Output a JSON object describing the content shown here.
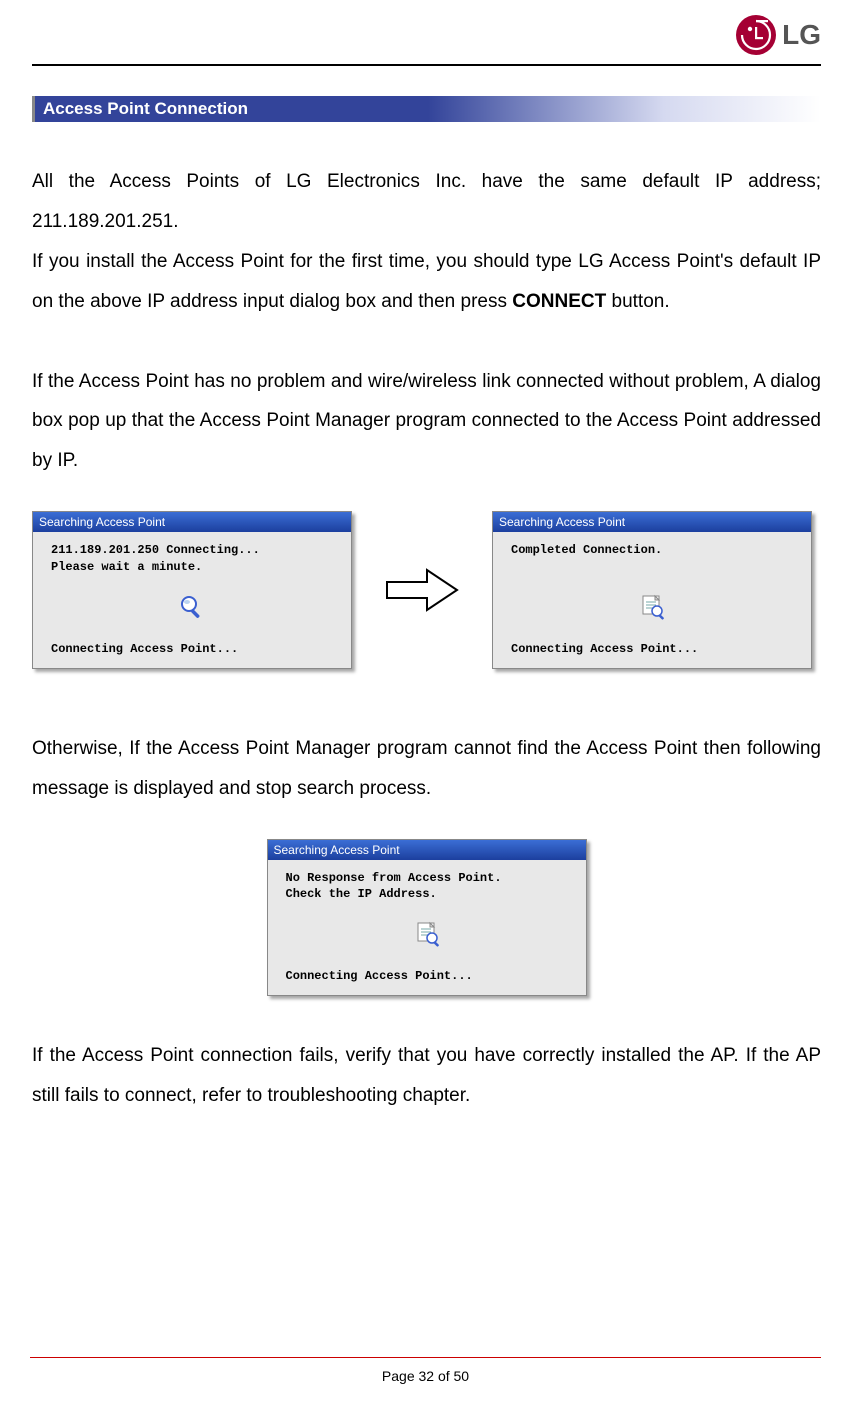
{
  "logo": {
    "text": "LG"
  },
  "section": {
    "title": "Access Point Connection"
  },
  "para1_full": "All the Access Points of LG Electronics Inc. have the same default IP address; 211.189.201.251.",
  "para2_a": "If you install the Access Point for the first time, you should type LG Access Point's default IP on the above IP address input dialog box and then press ",
  "para2_bold": "CONNECT",
  "para2_b": " button.",
  "para3": "If the Access Point has no problem and wire/wireless link connected without problem, A dialog box pop up that the Access Point Manager program connected to the Access Point addressed by IP.",
  "dialog1": {
    "title": "Searching Access Point",
    "line1": "211.189.201.250 Connecting...",
    "line2": "Please wait a minute.",
    "status": "Connecting Access Point..."
  },
  "dialog2": {
    "title": "Searching Access Point",
    "line1": "Completed Connection.",
    "status": "Connecting Access Point..."
  },
  "para4": "Otherwise, If the Access Point Manager program cannot find the Access Point then following message is displayed and stop search process.",
  "dialog3": {
    "title": "Searching Access Point",
    "line1": "No Response from Access Point.",
    "line2": "Check the IP Address.",
    "status": "Connecting Access Point..."
  },
  "para5": "If the Access Point connection fails, verify that you have correctly installed the AP. If the AP still fails to connect, refer to troubleshooting chapter.",
  "footer": {
    "page": "Page 32 of 50"
  }
}
